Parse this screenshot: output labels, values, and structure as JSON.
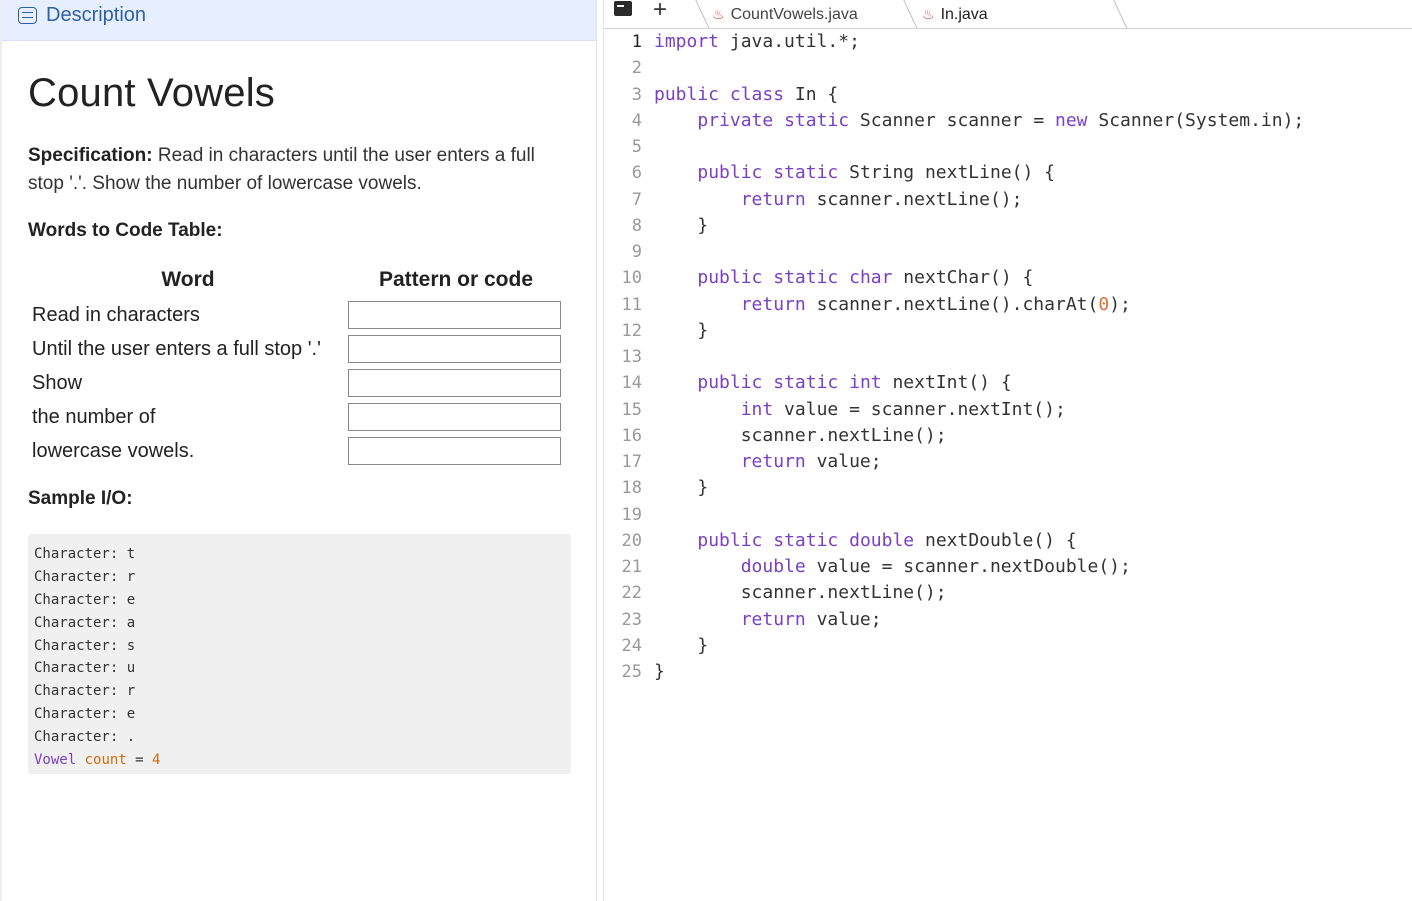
{
  "left": {
    "tab_label": "Description",
    "title": "Count Vowels",
    "spec_label": "Specification:",
    "spec_text": " Read in characters until the user enters a full stop '.'. Show the number of lowercase vowels.",
    "table_heading": "Words to Code Table:",
    "table": {
      "col_word": "Word",
      "col_code": "Pattern or code",
      "rows": [
        "Read in characters",
        "Until the user enters a full stop '.'",
        "Show",
        "the number of",
        "lowercase vowels."
      ]
    },
    "sample_heading": "Sample I/O:",
    "sample_io": [
      "Character: t",
      "Character: r",
      "Character: e",
      "Character: a",
      "Character: s",
      "Character: u",
      "Character: r",
      "Character: e",
      "Character: ."
    ],
    "sample_last": {
      "word1": "Vowel",
      "word2": "count",
      "eq": " = ",
      "value": "4"
    }
  },
  "editor": {
    "tabs": [
      "CountVowels.java",
      "In.java"
    ],
    "active_tab": "In.java"
  }
}
